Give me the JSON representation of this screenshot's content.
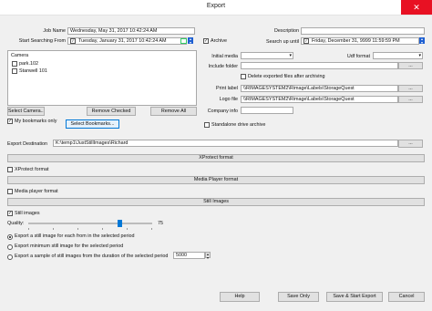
{
  "window": {
    "title": "Export",
    "close_glyph": "✕"
  },
  "job": {
    "name_label": "Job Name",
    "name_value": "Wednesday, May 31, 2017 10:42:24 AM",
    "start_label": "Start Searching From",
    "start_value": "Tuesday, January 31, 2017 10:42:24 AM",
    "calendar_icon": "calendar-icon"
  },
  "description": {
    "label": "Description",
    "value": ""
  },
  "archive": {
    "checkbox_label": "Archive",
    "search_up_label": "Search up until",
    "search_up_value": "Friday, December 31, 9999 11:59:59 PM"
  },
  "cameras": {
    "header": "Camera",
    "items": [
      {
        "label": "park.102"
      },
      {
        "label": "Stanwell 101"
      }
    ],
    "select_button": "Select Camera...",
    "remove_checked_button": "Remove Checked",
    "remove_all_button": "Remove All"
  },
  "bookmarks": {
    "checkbox_label": "My bookmarks only",
    "select_button": "Select Bookmarks..."
  },
  "right_fields": {
    "initial_media_label": "Initial media",
    "udf_format_label": "Udf format",
    "include_folder_label": "Include folder",
    "delete_label": "Delete exported files after archiving",
    "print_label_label": "Print label",
    "print_label_value": "\\\\RIMAGESYSTEM2\\Rimage\\Labels\\StorageQuest",
    "logo_file_label": "Logo file",
    "logo_file_value": "\\\\RIMAGESYSTEM2\\Rimage\\Labels\\StorageQuest",
    "company_info_label": "Company info",
    "standalone_label": "Standalone drive archive",
    "browse_label": "..."
  },
  "destination": {
    "label": "Export Destination",
    "value": "K:\\temp1\\JustStillImages\\Richard",
    "browse_label": "..."
  },
  "sections": {
    "xprotect": "XProtect format",
    "xprotect_checkbox": "XProtect format",
    "media_player": "Media Player format",
    "media_player_checkbox": "Media player format",
    "still_images": "Still Images",
    "still_images_checkbox": "Still images"
  },
  "quality": {
    "label": "Quality:",
    "value": "75",
    "fraction": 0.75
  },
  "still_options": [
    {
      "label": "Export a still image for each from in the selected period",
      "selected": true
    },
    {
      "label": "Export minimum still image for the selected period",
      "selected": false
    },
    {
      "label": "Export a sample of still images from the duration of the selected period",
      "selected": false
    }
  ],
  "sample_value": "5000",
  "footer": {
    "help": "Help",
    "save_only": "Save Only",
    "save_start": "Save & Start Export",
    "cancel": "Cancel"
  },
  "colors": {
    "accent": "#0078d7",
    "close": "#e81123",
    "spinner": "#1e5fd1"
  }
}
